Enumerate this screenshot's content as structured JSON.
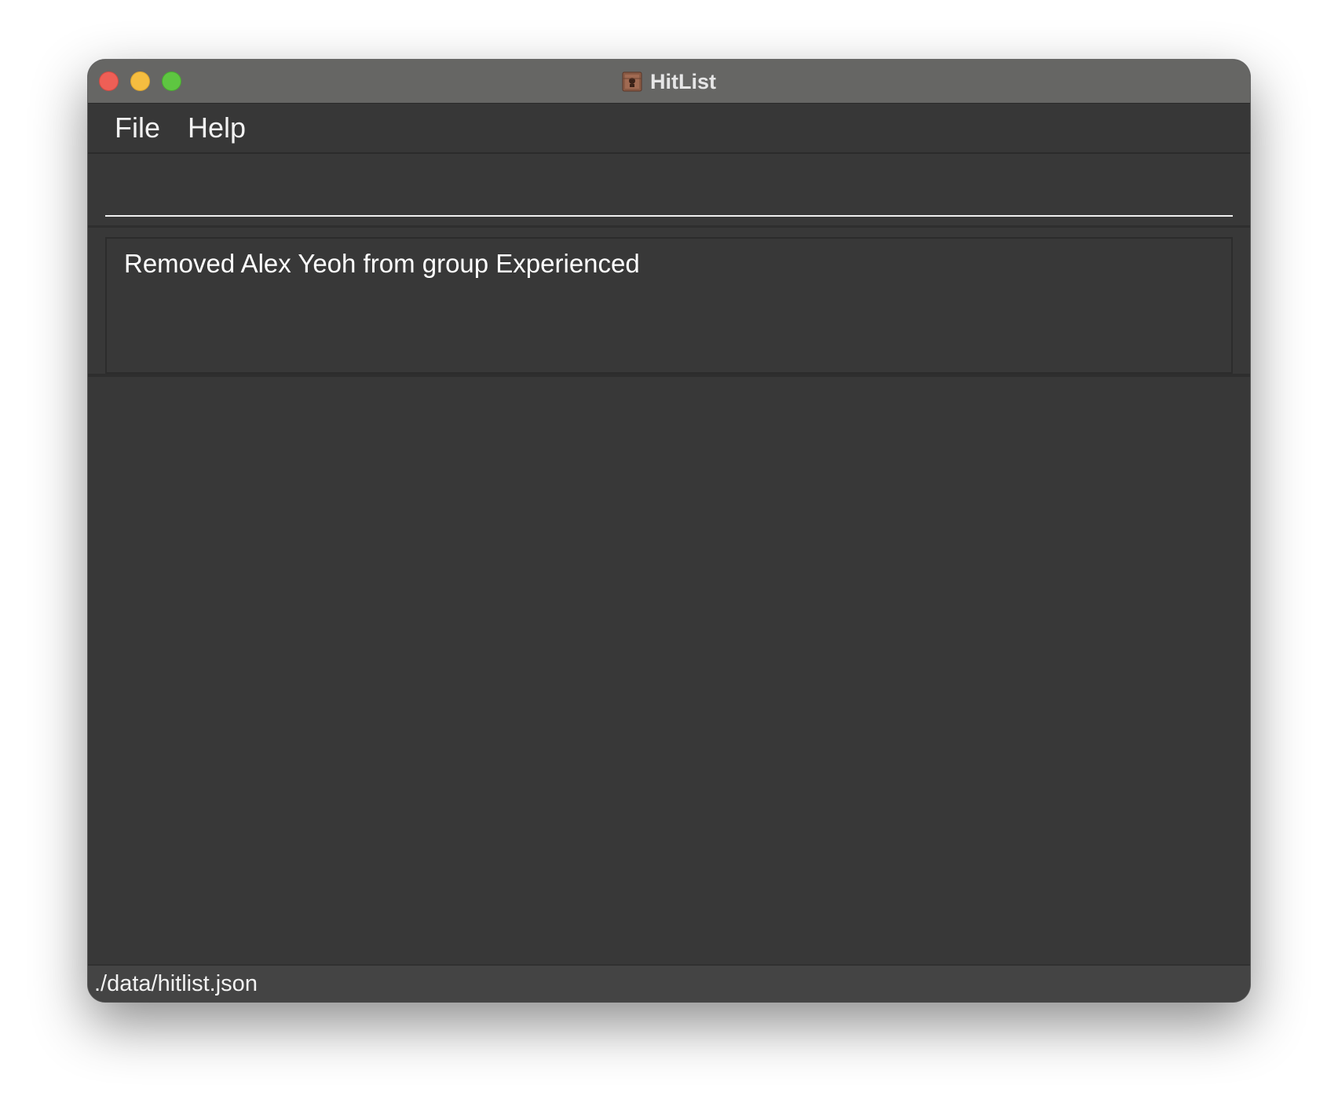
{
  "window": {
    "title": "HitList",
    "app_icon": "hitlist-app-icon",
    "controls": [
      "close",
      "minimize",
      "zoom"
    ]
  },
  "menubar": {
    "items": [
      {
        "label": "File"
      },
      {
        "label": "Help"
      }
    ]
  },
  "command_box": {
    "value": "",
    "placeholder": ""
  },
  "result_display": {
    "text": "Removed Alex Yeoh from group Experienced"
  },
  "status_bar": {
    "file_path": "./data/hitlist.json"
  },
  "colors": {
    "background": "#383838",
    "titlebar": "#666664",
    "close": "#ee5f56",
    "minimize": "#f5bd40",
    "zoom": "#5ec641",
    "text": "#ffffff"
  }
}
